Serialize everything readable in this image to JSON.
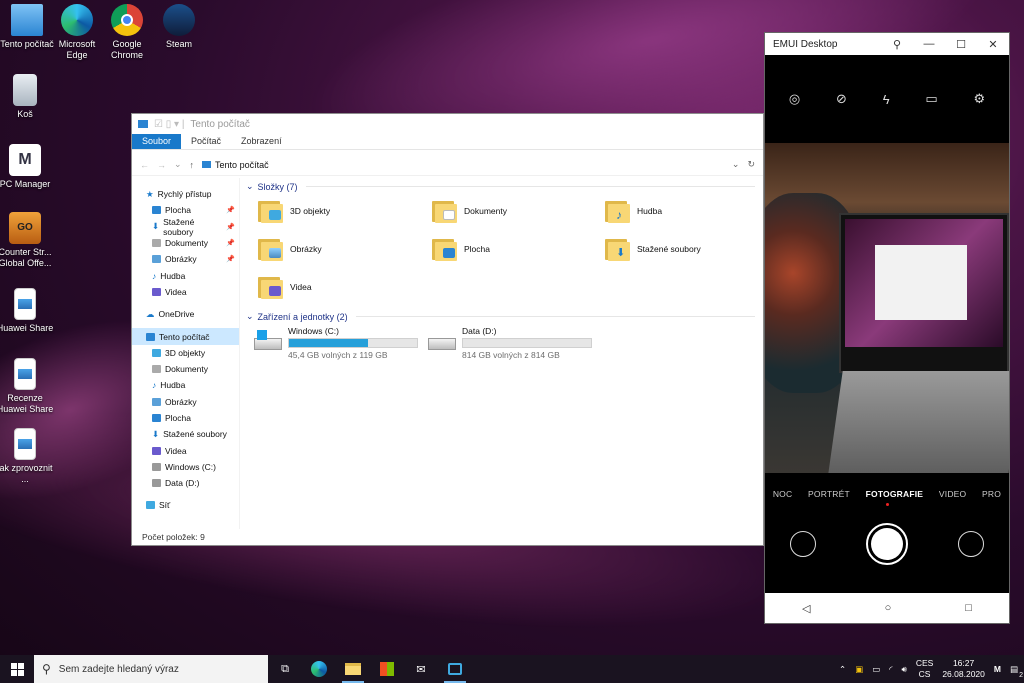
{
  "desktop": {
    "icons": [
      {
        "label": "Tento počítač",
        "icon": "computer-icon"
      },
      {
        "label": "Microsoft Edge",
        "icon": "edge-icon"
      },
      {
        "label": "Google Chrome",
        "icon": "chrome-icon"
      },
      {
        "label": "Steam",
        "icon": "steam-icon"
      },
      {
        "label": "Koš",
        "icon": "recycle-bin-icon"
      },
      {
        "label": "PC Manager",
        "icon": "pc-manager-icon"
      },
      {
        "label": "Counter Str... Global Offe...",
        "icon": "csgo-icon"
      },
      {
        "label": "Huawei Share",
        "icon": "image-file-icon"
      },
      {
        "label": "Recenze Huawei Share",
        "icon": "image-file-icon"
      },
      {
        "label": "jak zprovoznit ...",
        "icon": "image-file-icon"
      }
    ]
  },
  "explorer": {
    "title": "Tento počítač",
    "tabs": [
      "Soubor",
      "Počítač",
      "Zobrazení"
    ],
    "address": "Tento počítač",
    "nav": {
      "quick_access": "Rychlý přístup",
      "quick_items": [
        "Plocha",
        "Stažené soubory",
        "Dokumenty",
        "Obrázky",
        "Hudba",
        "Videa"
      ],
      "onedrive": "OneDrive",
      "this_pc": "Tento počítač",
      "pc_items": [
        "3D objekty",
        "Dokumenty",
        "Hudba",
        "Obrázky",
        "Plocha",
        "Stažené soubory",
        "Videa",
        "Windows (C:)",
        "Data (D:)"
      ],
      "network": "Síť"
    },
    "folders_header": "Složky (7)",
    "folders": [
      "3D objekty",
      "Dokumenty",
      "Hudba",
      "Obrázky",
      "Plocha",
      "Stažené soubory",
      "Videa"
    ],
    "devices_header": "Zařízení a jednotky (2)",
    "drives": [
      {
        "name": "Windows (C:)",
        "free": "45,4 GB volných z 119 GB",
        "used_fraction": 0.62
      },
      {
        "name": "Data (D:)",
        "free": "814 GB volných z 814 GB",
        "used_fraction": 0.0
      }
    ],
    "status": "Počet položek: 9"
  },
  "phone": {
    "title": "EMUI Desktop",
    "modes": [
      "NOC",
      "PORTRÉT",
      "FOTOGRAFIE",
      "VIDEO",
      "PRO"
    ],
    "active_mode": "FOTOGRAFIE"
  },
  "taskbar": {
    "search_placeholder": "Sem zadejte hledaný výraz",
    "lang_top": "CES",
    "lang_bottom": "CS",
    "time": "16:27",
    "date": "26.08.2020",
    "notifications": "2"
  }
}
